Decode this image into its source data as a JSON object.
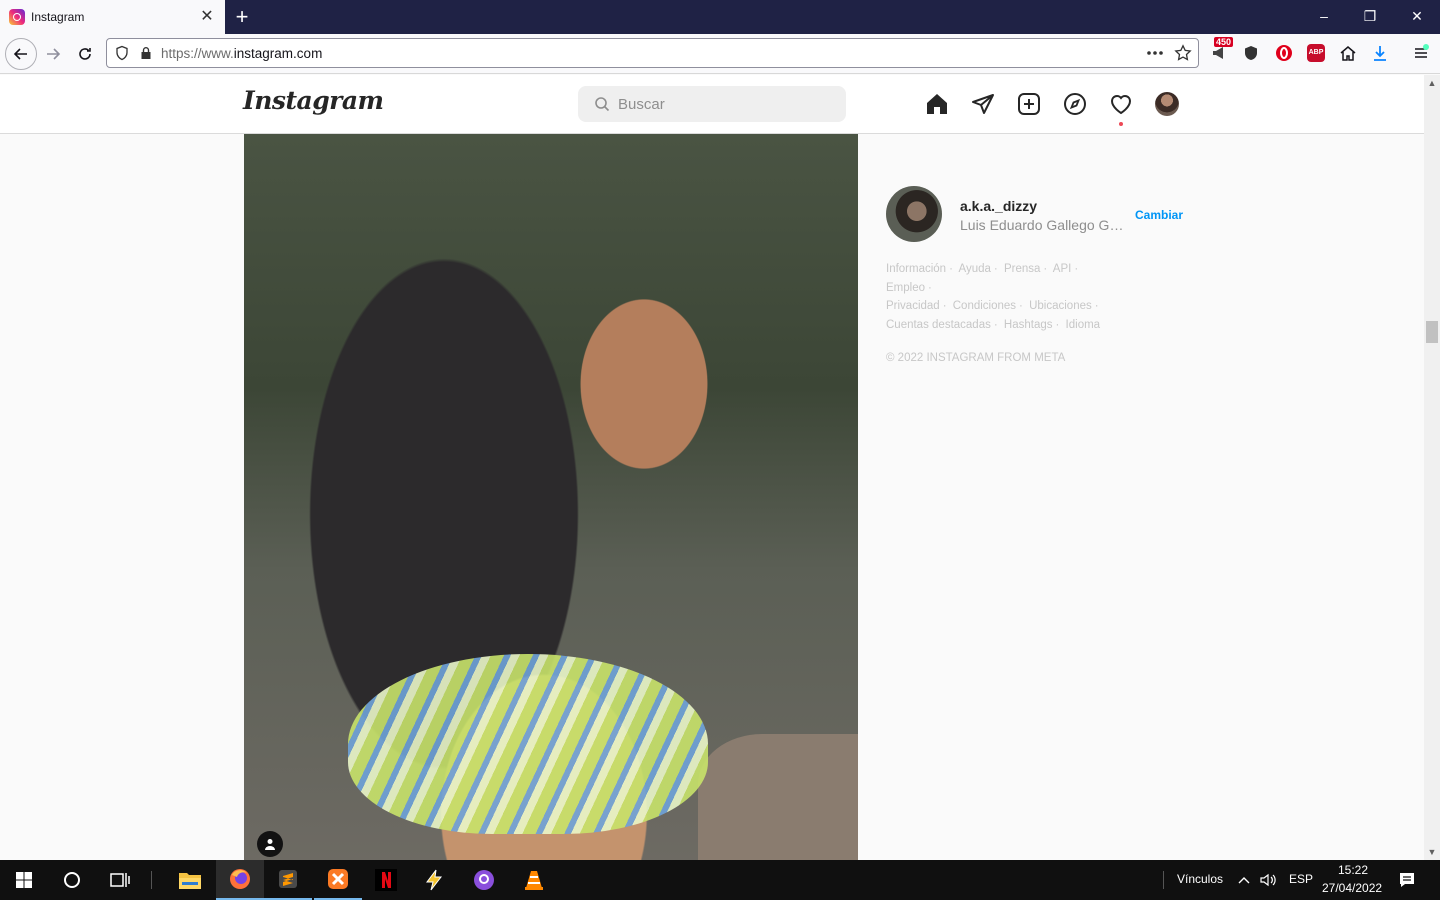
{
  "browser": {
    "tab": {
      "title": "Instagram",
      "close": "✕"
    },
    "new_tab": "+",
    "window_controls": {
      "minimize": "–",
      "restore": "❐",
      "close": "✕"
    },
    "url": {
      "prefix": "https://www.",
      "host": "instagram.com"
    },
    "extensions": {
      "badge_count": "450",
      "abp_label": "ABP"
    }
  },
  "instagram": {
    "logo": "Instagram",
    "search": {
      "placeholder": "Buscar"
    },
    "nav_icons": [
      "home-icon",
      "direct-icon",
      "new-post-icon",
      "explore-icon",
      "activity-icon",
      "profile-icon"
    ],
    "accent": "#0095f6",
    "notification_color": "#ed4956"
  },
  "sidebar": {
    "username": "a.k.a._dizzy",
    "full_name": "Luis Eduardo Gallego Gar...",
    "switch_label": "Cambiar",
    "footer_links": [
      "Información",
      "Ayuda",
      "Prensa",
      "API",
      "Empleo",
      "Privacidad",
      "Condiciones",
      "Ubicaciones",
      "Cuentas destacadas",
      "Hashtags",
      "Idioma"
    ],
    "copyright": "© 2022 INSTAGRAM FROM META"
  },
  "taskbar": {
    "links_label": "Vínculos",
    "language": "ESP",
    "time": "15:22",
    "date": "27/04/2022"
  }
}
